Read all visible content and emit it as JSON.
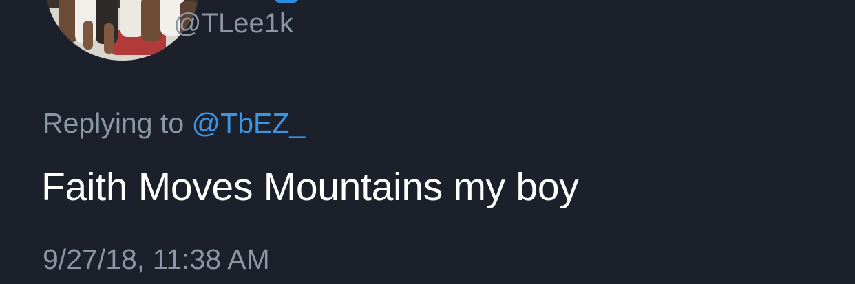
{
  "author": {
    "handle": "@TLee1k",
    "avatar_icon": "profile-photo",
    "verified_icon": "verified-badge-icon"
  },
  "tweet": {
    "reply_prefix": "Replying to",
    "reply_to": "@TbEZ_",
    "text": "Faith Moves Mountains my boy",
    "timestamp": "9/27/18, 11:38 AM"
  },
  "colors": {
    "background": "#1b202a",
    "primary_text": "#ffffff",
    "secondary_text": "#8b97a4",
    "link": "#3b95e5"
  }
}
